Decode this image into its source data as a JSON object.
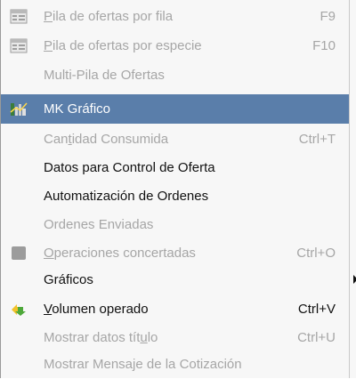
{
  "menu": {
    "items": [
      {
        "label_pre": "",
        "label_u": "P",
        "label_post": "ila de ofertas por fila",
        "shortcut": "F9",
        "state": "disabled",
        "icon": "grid-window-icon"
      },
      {
        "label_pre": "",
        "label_u": "P",
        "label_post": "ila de ofertas por especie",
        "shortcut": "F10",
        "state": "disabled",
        "icon": "grid-window-icon"
      },
      {
        "label_pre": "Multi-Pila de Ofertas",
        "label_u": "",
        "label_post": "",
        "shortcut": "",
        "state": "disabled",
        "icon": ""
      },
      {
        "label_pre": "MK Gráfico",
        "label_u": "",
        "label_post": "",
        "shortcut": "",
        "state": "selected",
        "icon": "chart-icon"
      },
      {
        "label_pre": "Can",
        "label_u": "t",
        "label_post": "idad Consumida",
        "shortcut": "Ctrl+T",
        "state": "disabled",
        "icon": ""
      },
      {
        "label_pre": "Datos para Control de Oferta",
        "label_u": "",
        "label_post": "",
        "shortcut": "",
        "state": "enabled",
        "icon": ""
      },
      {
        "label_pre": "Automatización de Ordenes",
        "label_u": "",
        "label_post": "",
        "shortcut": "",
        "state": "enabled",
        "icon": ""
      },
      {
        "label_pre": "Ordenes Enviadas",
        "label_u": "",
        "label_post": "",
        "shortcut": "",
        "state": "disabled",
        "icon": ""
      },
      {
        "label_pre": "",
        "label_u": "O",
        "label_post": "peraciones concertadas",
        "shortcut": "Ctrl+O",
        "state": "disabled",
        "icon": "gray-square-icon"
      },
      {
        "label_pre": "Gráficos",
        "label_u": "",
        "label_post": "",
        "shortcut": "",
        "state": "enabled",
        "icon": ""
      },
      {
        "label_pre": "",
        "label_u": "V",
        "label_post": "olumen operado",
        "shortcut": "Ctrl+V",
        "state": "enabled",
        "icon": "volume-arrow-icon"
      },
      {
        "label_pre": "Mostrar datos tít",
        "label_u": "u",
        "label_post": "lo",
        "shortcut": "Ctrl+U",
        "state": "disabled",
        "icon": ""
      },
      {
        "label_pre": "Mostrar Mensaje de la Cotización",
        "label_u": "",
        "label_post": "",
        "shortcut": "",
        "state": "disabled",
        "icon": ""
      }
    ]
  },
  "colors": {
    "menu_bg": "#f7f7f7",
    "selected_bg": "#5a7eaa",
    "disabled_text": "#a6a6a6",
    "enabled_text": "#111111"
  }
}
